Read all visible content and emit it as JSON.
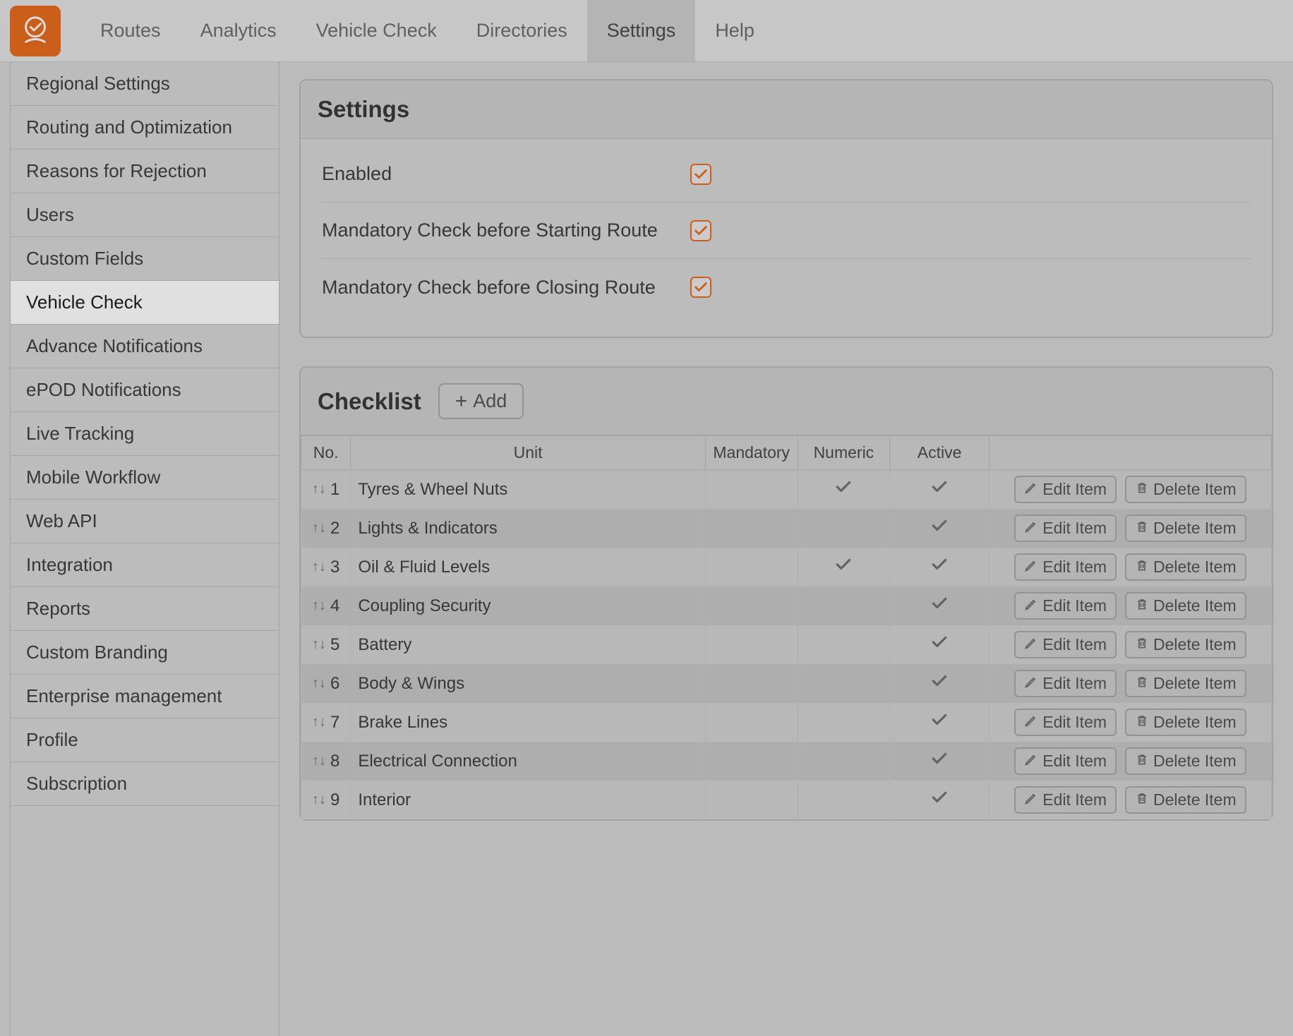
{
  "nav": {
    "items": [
      "Routes",
      "Analytics",
      "Vehicle Check",
      "Directories",
      "Settings",
      "Help"
    ],
    "active_index": 4
  },
  "sidebar": {
    "items": [
      "Regional Settings",
      "Routing and Optimization",
      "Reasons for Rejection",
      "Users",
      "Custom Fields",
      "Vehicle Check",
      "Advance Notifications",
      "ePOD Notifications",
      "Live Tracking",
      "Mobile Workflow",
      "Web API",
      "Integration",
      "Reports",
      "Custom Branding",
      "Enterprise management",
      "Profile",
      "Subscription"
    ],
    "active_index": 5
  },
  "settings_panel": {
    "title": "Settings",
    "rows": [
      {
        "label": "Enabled",
        "checked": true
      },
      {
        "label": "Mandatory Check before Starting Route",
        "checked": true
      },
      {
        "label": "Mandatory Check before Closing Route",
        "checked": true
      }
    ]
  },
  "checklist_panel": {
    "title": "Checklist",
    "add_label": "Add",
    "columns": [
      "No.",
      "Unit",
      "Mandatory",
      "Numeric",
      "Active",
      ""
    ],
    "edit_label": "Edit Item",
    "delete_label": "Delete Item",
    "rows": [
      {
        "no": 1,
        "unit": "Tyres & Wheel Nuts",
        "mandatory": false,
        "numeric": true,
        "active": true
      },
      {
        "no": 2,
        "unit": "Lights & Indicators",
        "mandatory": false,
        "numeric": false,
        "active": true
      },
      {
        "no": 3,
        "unit": "Oil & Fluid Levels",
        "mandatory": false,
        "numeric": true,
        "active": true
      },
      {
        "no": 4,
        "unit": "Coupling Security",
        "mandatory": false,
        "numeric": false,
        "active": true
      },
      {
        "no": 5,
        "unit": "Battery",
        "mandatory": false,
        "numeric": false,
        "active": true
      },
      {
        "no": 6,
        "unit": "Body & Wings",
        "mandatory": false,
        "numeric": false,
        "active": true
      },
      {
        "no": 7,
        "unit": "Brake Lines",
        "mandatory": false,
        "numeric": false,
        "active": true
      },
      {
        "no": 8,
        "unit": "Electrical Connection",
        "mandatory": false,
        "numeric": false,
        "active": true
      },
      {
        "no": 9,
        "unit": "Interior",
        "mandatory": false,
        "numeric": false,
        "active": true
      }
    ]
  }
}
